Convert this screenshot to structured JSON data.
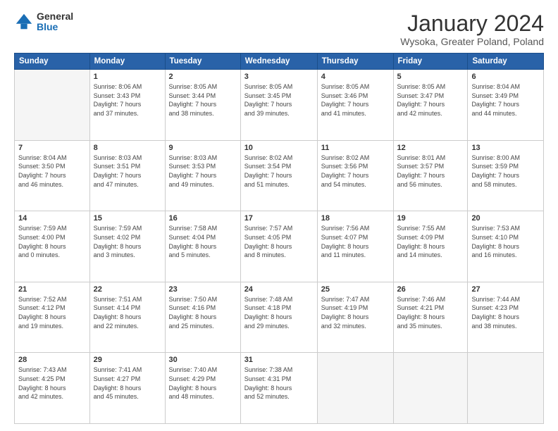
{
  "logo": {
    "general": "General",
    "blue": "Blue"
  },
  "header": {
    "title": "January 2024",
    "subtitle": "Wysoka, Greater Poland, Poland"
  },
  "calendar": {
    "days_of_week": [
      "Sunday",
      "Monday",
      "Tuesday",
      "Wednesday",
      "Thursday",
      "Friday",
      "Saturday"
    ],
    "weeks": [
      [
        {
          "day": "",
          "info": ""
        },
        {
          "day": "1",
          "info": "Sunrise: 8:06 AM\nSunset: 3:43 PM\nDaylight: 7 hours\nand 37 minutes."
        },
        {
          "day": "2",
          "info": "Sunrise: 8:05 AM\nSunset: 3:44 PM\nDaylight: 7 hours\nand 38 minutes."
        },
        {
          "day": "3",
          "info": "Sunrise: 8:05 AM\nSunset: 3:45 PM\nDaylight: 7 hours\nand 39 minutes."
        },
        {
          "day": "4",
          "info": "Sunrise: 8:05 AM\nSunset: 3:46 PM\nDaylight: 7 hours\nand 41 minutes."
        },
        {
          "day": "5",
          "info": "Sunrise: 8:05 AM\nSunset: 3:47 PM\nDaylight: 7 hours\nand 42 minutes."
        },
        {
          "day": "6",
          "info": "Sunrise: 8:04 AM\nSunset: 3:49 PM\nDaylight: 7 hours\nand 44 minutes."
        }
      ],
      [
        {
          "day": "7",
          "info": "Sunrise: 8:04 AM\nSunset: 3:50 PM\nDaylight: 7 hours\nand 46 minutes."
        },
        {
          "day": "8",
          "info": "Sunrise: 8:03 AM\nSunset: 3:51 PM\nDaylight: 7 hours\nand 47 minutes."
        },
        {
          "day": "9",
          "info": "Sunrise: 8:03 AM\nSunset: 3:53 PM\nDaylight: 7 hours\nand 49 minutes."
        },
        {
          "day": "10",
          "info": "Sunrise: 8:02 AM\nSunset: 3:54 PM\nDaylight: 7 hours\nand 51 minutes."
        },
        {
          "day": "11",
          "info": "Sunrise: 8:02 AM\nSunset: 3:56 PM\nDaylight: 7 hours\nand 54 minutes."
        },
        {
          "day": "12",
          "info": "Sunrise: 8:01 AM\nSunset: 3:57 PM\nDaylight: 7 hours\nand 56 minutes."
        },
        {
          "day": "13",
          "info": "Sunrise: 8:00 AM\nSunset: 3:59 PM\nDaylight: 7 hours\nand 58 minutes."
        }
      ],
      [
        {
          "day": "14",
          "info": "Sunrise: 7:59 AM\nSunset: 4:00 PM\nDaylight: 8 hours\nand 0 minutes."
        },
        {
          "day": "15",
          "info": "Sunrise: 7:59 AM\nSunset: 4:02 PM\nDaylight: 8 hours\nand 3 minutes."
        },
        {
          "day": "16",
          "info": "Sunrise: 7:58 AM\nSunset: 4:04 PM\nDaylight: 8 hours\nand 5 minutes."
        },
        {
          "day": "17",
          "info": "Sunrise: 7:57 AM\nSunset: 4:05 PM\nDaylight: 8 hours\nand 8 minutes."
        },
        {
          "day": "18",
          "info": "Sunrise: 7:56 AM\nSunset: 4:07 PM\nDaylight: 8 hours\nand 11 minutes."
        },
        {
          "day": "19",
          "info": "Sunrise: 7:55 AM\nSunset: 4:09 PM\nDaylight: 8 hours\nand 14 minutes."
        },
        {
          "day": "20",
          "info": "Sunrise: 7:53 AM\nSunset: 4:10 PM\nDaylight: 8 hours\nand 16 minutes."
        }
      ],
      [
        {
          "day": "21",
          "info": "Sunrise: 7:52 AM\nSunset: 4:12 PM\nDaylight: 8 hours\nand 19 minutes."
        },
        {
          "day": "22",
          "info": "Sunrise: 7:51 AM\nSunset: 4:14 PM\nDaylight: 8 hours\nand 22 minutes."
        },
        {
          "day": "23",
          "info": "Sunrise: 7:50 AM\nSunset: 4:16 PM\nDaylight: 8 hours\nand 25 minutes."
        },
        {
          "day": "24",
          "info": "Sunrise: 7:48 AM\nSunset: 4:18 PM\nDaylight: 8 hours\nand 29 minutes."
        },
        {
          "day": "25",
          "info": "Sunrise: 7:47 AM\nSunset: 4:19 PM\nDaylight: 8 hours\nand 32 minutes."
        },
        {
          "day": "26",
          "info": "Sunrise: 7:46 AM\nSunset: 4:21 PM\nDaylight: 8 hours\nand 35 minutes."
        },
        {
          "day": "27",
          "info": "Sunrise: 7:44 AM\nSunset: 4:23 PM\nDaylight: 8 hours\nand 38 minutes."
        }
      ],
      [
        {
          "day": "28",
          "info": "Sunrise: 7:43 AM\nSunset: 4:25 PM\nDaylight: 8 hours\nand 42 minutes."
        },
        {
          "day": "29",
          "info": "Sunrise: 7:41 AM\nSunset: 4:27 PM\nDaylight: 8 hours\nand 45 minutes."
        },
        {
          "day": "30",
          "info": "Sunrise: 7:40 AM\nSunset: 4:29 PM\nDaylight: 8 hours\nand 48 minutes."
        },
        {
          "day": "31",
          "info": "Sunrise: 7:38 AM\nSunset: 4:31 PM\nDaylight: 8 hours\nand 52 minutes."
        },
        {
          "day": "",
          "info": ""
        },
        {
          "day": "",
          "info": ""
        },
        {
          "day": "",
          "info": ""
        }
      ]
    ]
  }
}
